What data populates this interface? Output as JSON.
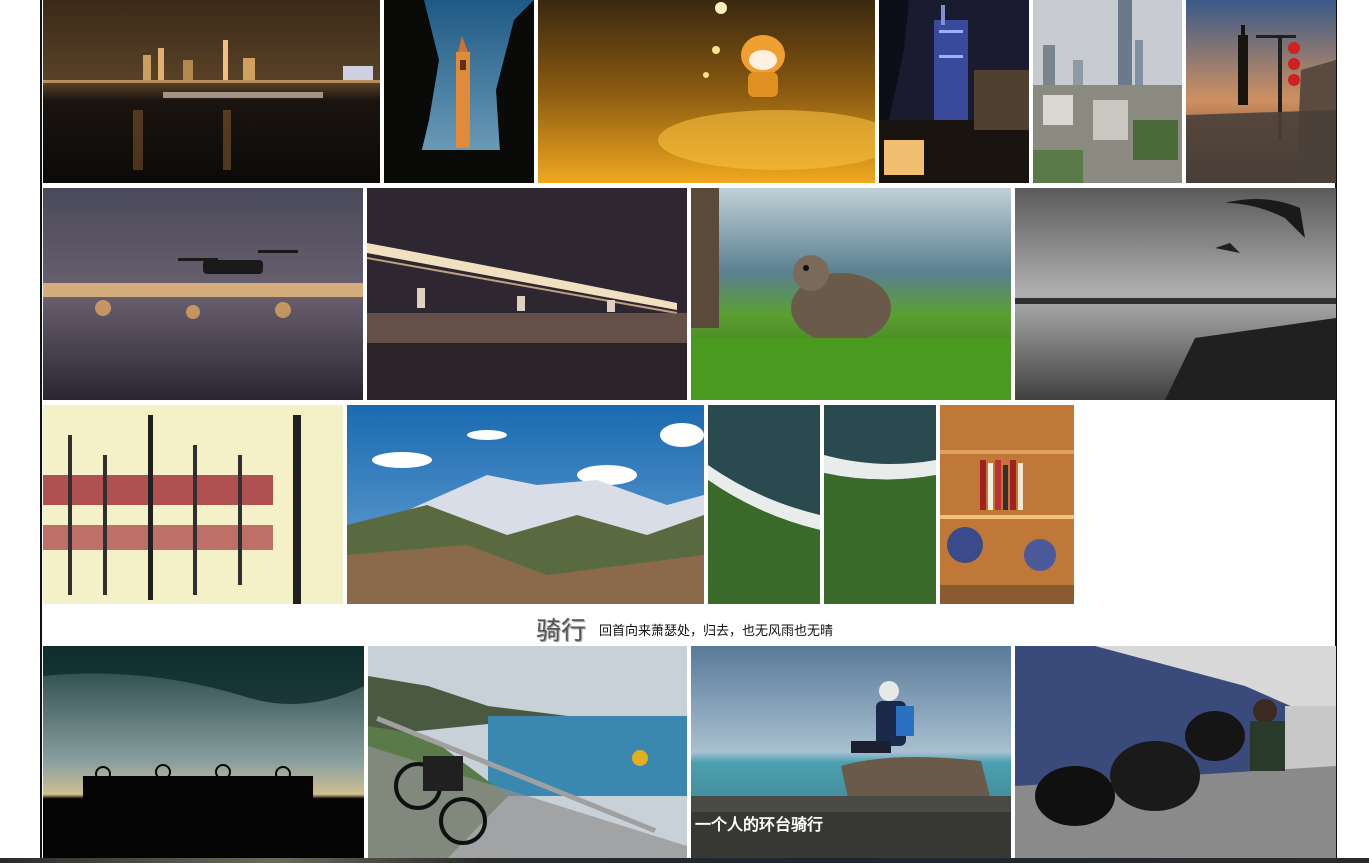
{
  "gallery": {
    "photos": [
      {
        "id": "p1",
        "subject": "city-skyline-night-river"
      },
      {
        "id": "p2",
        "subject": "clock-tower-dusk"
      },
      {
        "id": "p3",
        "subject": "toy-figure-street-night"
      },
      {
        "id": "p4",
        "subject": "skyscraper-night"
      },
      {
        "id": "p5",
        "subject": "city-skyline-day"
      },
      {
        "id": "p6",
        "subject": "city-wall-lanterns-sunset"
      },
      {
        "id": "p7",
        "subject": "drone-over-bridge-night"
      },
      {
        "id": "p8",
        "subject": "bridge-lights-night"
      },
      {
        "id": "p9",
        "subject": "squirrel-on-grass"
      },
      {
        "id": "p10",
        "subject": "seagulls-pier-monochrome"
      },
      {
        "id": "p11",
        "subject": "boat-reflection-poles"
      },
      {
        "id": "p12",
        "subject": "snow-mountains-valley"
      },
      {
        "id": "p13",
        "subject": "coast-aerial-waves"
      },
      {
        "id": "p14",
        "subject": "coast-aerial-waves-2"
      },
      {
        "id": "p15",
        "subject": "figure-collection-shelf"
      }
    ],
    "cycling_photos": [
      {
        "id": "c1",
        "subject": "cyclists-silhouette-dusk"
      },
      {
        "id": "c2",
        "subject": "touring-bike-coastal-road"
      },
      {
        "id": "c3",
        "subject": "cyclist-sitting-on-rock-sea",
        "caption": "一个人的环台骑行"
      },
      {
        "id": "c4",
        "subject": "cyclist-resting-with-bike"
      }
    ]
  },
  "section": {
    "title": "骑行",
    "subtitle": "回首向来萧瑟处，归去，也无风雨也无晴"
  }
}
